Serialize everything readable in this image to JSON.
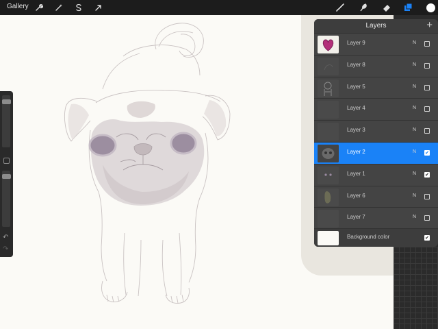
{
  "app": {
    "gallery_label": "Gallery"
  },
  "toolbar_left": [
    {
      "name": "actions-wrench-icon",
      "glyph": "wrench"
    },
    {
      "name": "adjustments-wand-icon",
      "glyph": "wand"
    },
    {
      "name": "selection-s-icon",
      "glyph": "S"
    },
    {
      "name": "transform-arrow-icon",
      "glyph": "arrow"
    }
  ],
  "toolbar_right": [
    {
      "name": "brush-icon"
    },
    {
      "name": "smudge-icon"
    },
    {
      "name": "eraser-icon"
    },
    {
      "name": "layers-icon",
      "active": true
    },
    {
      "name": "color-swatch-icon",
      "color": "#ffffff"
    }
  ],
  "colors": {
    "accent": "#1a82f7",
    "panel": "#3d3d3d",
    "topbar": "#1c1c1c",
    "canvas": "#fbfaf6"
  },
  "layers_panel": {
    "title": "Layers",
    "add_label": "+",
    "layers": [
      {
        "name": "Layer 9",
        "blend": "N",
        "visible": false,
        "selected": false,
        "thumb": "heart"
      },
      {
        "name": "Layer 8",
        "blend": "N",
        "visible": false,
        "selected": false,
        "thumb": "dark"
      },
      {
        "name": "Layer 5",
        "blend": "N",
        "visible": false,
        "selected": false,
        "thumb": "sketch"
      },
      {
        "name": "Layer 4",
        "blend": "N",
        "visible": false,
        "selected": false,
        "thumb": "empty"
      },
      {
        "name": "Layer 3",
        "blend": "N",
        "visible": false,
        "selected": false,
        "thumb": "empty"
      },
      {
        "name": "Layer 2",
        "blend": "N",
        "visible": true,
        "selected": true,
        "thumb": "pug"
      },
      {
        "name": "Layer 1",
        "blend": "N",
        "visible": true,
        "selected": false,
        "thumb": "eyes"
      },
      {
        "name": "Layer 6",
        "blend": "N",
        "visible": false,
        "selected": false,
        "thumb": "figure"
      },
      {
        "name": "Layer 7",
        "blend": "N",
        "visible": false,
        "selected": false,
        "thumb": "empty"
      }
    ],
    "background": {
      "name": "Background color",
      "visible": true
    }
  },
  "sidebar": {
    "brush_size": 0.92,
    "opacity": 0.92
  }
}
